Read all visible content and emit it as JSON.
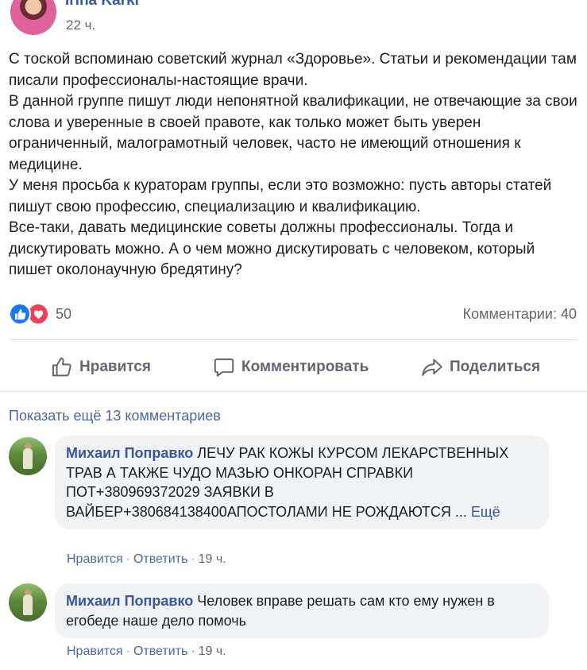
{
  "post": {
    "author": "Irina Karki",
    "time": "22 ч.",
    "paragraphs": [
      "С тоской вспоминаю советский журнал «Здоровье». Статьи и рекомендации там писали профессионалы-настоящие врачи.",
      "В данной группе пишут люди непонятной квалификации, не отвечающие за свои слова и уверенные в своей правоте, как только может быть уверен ограниченный, малограмотный человек, часто не имеющий отношения к медицине.",
      "У меня просьба к кураторам группы, если это возможно: пусть авторы статей пишут свою профессию, специализацию и квалификацию.",
      "Все-таки, давать медицинские советы должны профессионалы. Тогда и дискутировать можно. А о чем можно дискутировать с человеком, который пишет околонаучную бредятину?"
    ],
    "reactions_count": "50",
    "comments_count": "Комментарии: 40",
    "reaction_icons": [
      "like-icon",
      "love-icon"
    ],
    "actions": {
      "like": "Нравится",
      "comment": "Комментировать",
      "share": "Поделиться"
    }
  },
  "comments_section": {
    "show_more": "Показать ещё 13 комментариев",
    "comments": [
      {
        "author": "Михаил Поправко",
        "text": "ЛЕЧУ РАК КОЖЫ КУРСОМ ЛЕКАРСТВЕННЫХ ТРАВ А ТАКЖЕ ЧУДО МАЗЬЮ ОНКОРАН СПРАВКИ ПОТ+380969372029 ЗАЯВКИ В ВАЙБЕР+380684138400АПОСТОЛАМИ НЕ РОЖДАЮТСЯ ...",
        "see_more": "Ещё",
        "like": "Нравится",
        "reply": "Ответить",
        "time": "19 ч."
      },
      {
        "author": "Михаил Поправко",
        "text": "Человек вправе решать сам кто ему нужен в егобеде наше дело помочь",
        "like": "Нравится",
        "reply": "Ответить",
        "time": "19 ч."
      }
    ]
  },
  "colors": {
    "link": "#385898",
    "muted": "#606770",
    "like_blue": "#1877f2",
    "love_red": "#f33e58",
    "bubble_bg": "#f0f2f5"
  }
}
